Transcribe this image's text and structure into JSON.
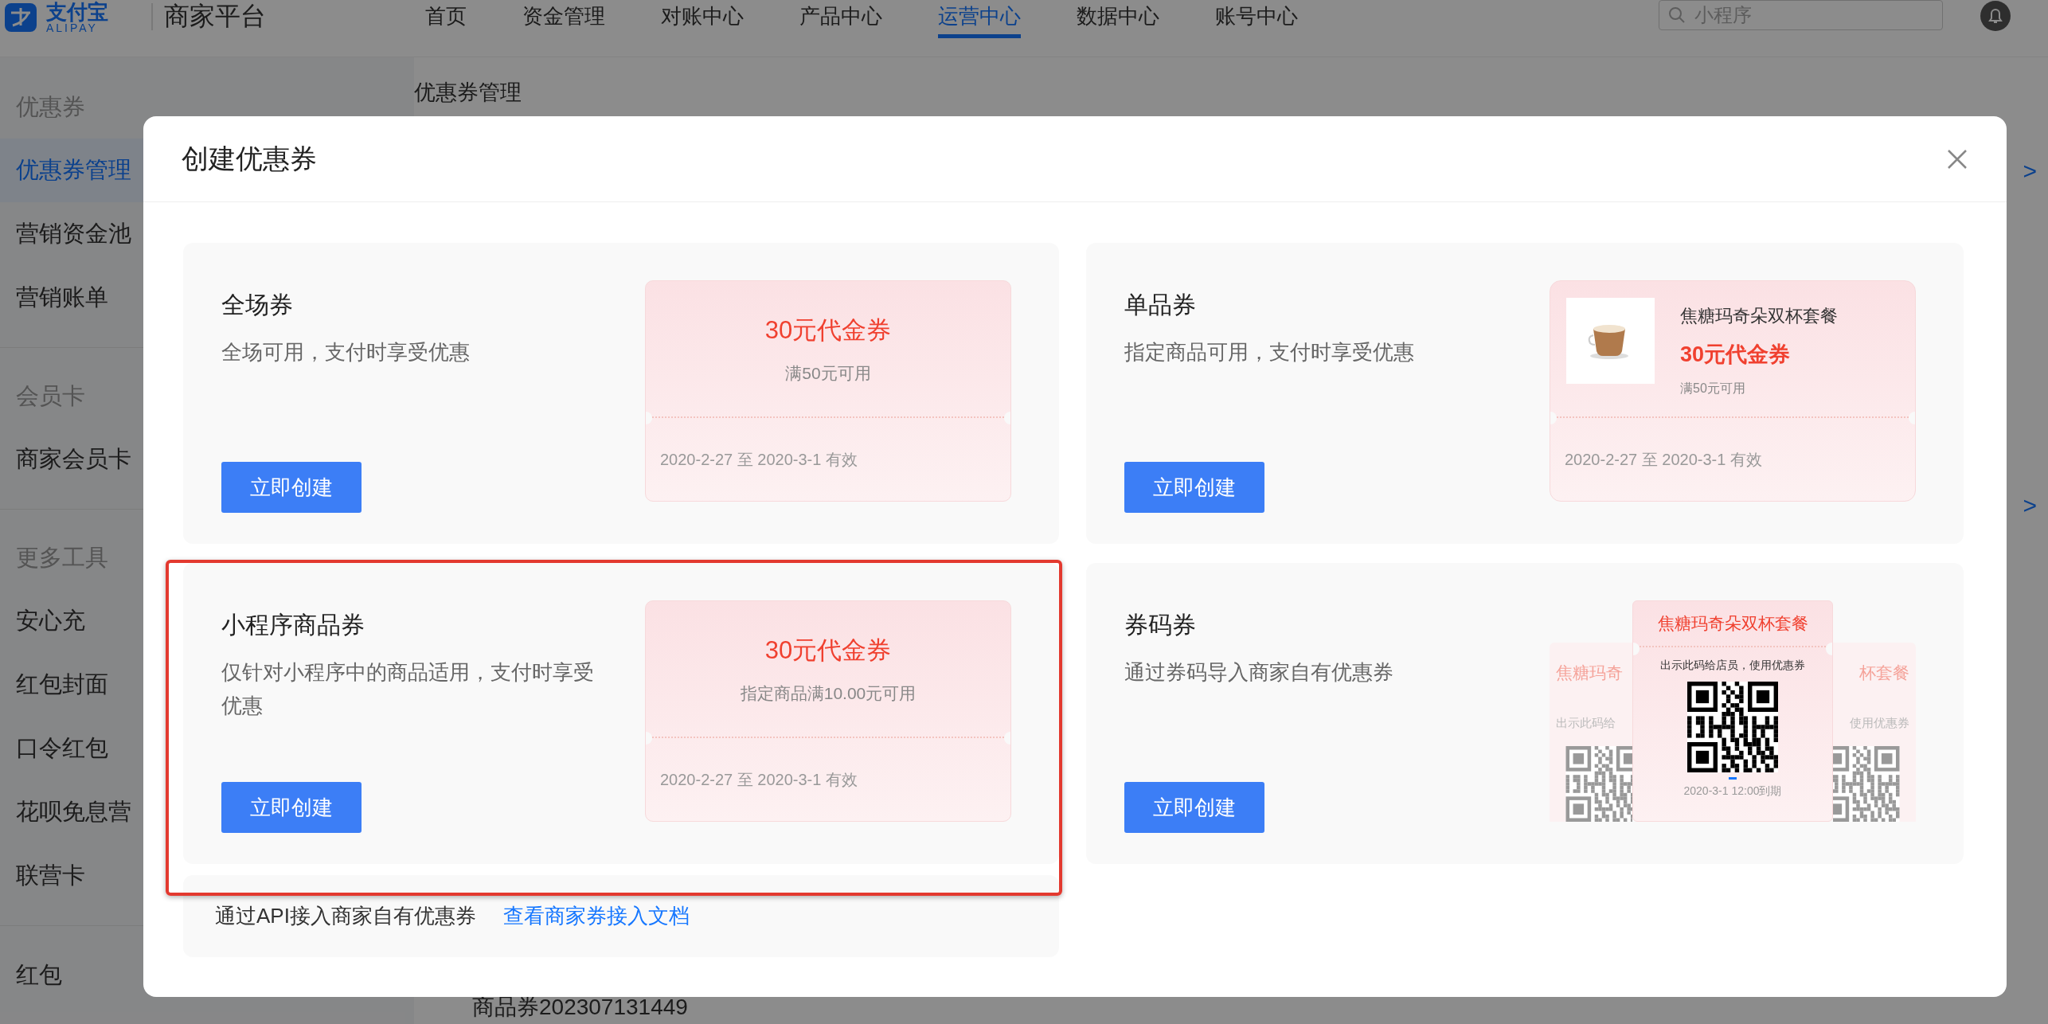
{
  "header": {
    "logo": {
      "name": "支付宝",
      "sub": "ALIPAY"
    },
    "platform": "商家平台",
    "nav": [
      {
        "label": "首页",
        "selected": false
      },
      {
        "label": "资金管理",
        "selected": false
      },
      {
        "label": "对账中心",
        "selected": false
      },
      {
        "label": "产品中心",
        "selected": false
      },
      {
        "label": "运营中心",
        "selected": true
      },
      {
        "label": "数据中心",
        "selected": false
      },
      {
        "label": "账号中心",
        "selected": false
      }
    ],
    "search": {
      "placeholder": "小程序"
    }
  },
  "sidebar": {
    "groups": [
      {
        "heading": "优惠券",
        "items": [
          {
            "label": "优惠券管理",
            "selected": true
          },
          {
            "label": "营销资金池",
            "selected": false
          },
          {
            "label": "营销账单",
            "selected": false
          }
        ]
      },
      {
        "heading": "会员卡",
        "items": [
          {
            "label": "商家会员卡",
            "selected": false
          }
        ]
      },
      {
        "heading": "更多工具",
        "items": [
          {
            "label": "安心充",
            "selected": false
          },
          {
            "label": "红包封面",
            "selected": false
          },
          {
            "label": "口令红包",
            "selected": false
          },
          {
            "label": "花呗免息营",
            "selected": false
          },
          {
            "label": "联营卡",
            "selected": false
          }
        ]
      },
      {
        "items": [
          {
            "label": "红包",
            "selected": false
          }
        ]
      }
    ]
  },
  "breadcrumb": "优惠券管理",
  "background_links": [
    ">",
    ">"
  ],
  "background_row": "商品券202307131449",
  "dialog": {
    "title": "创建优惠券",
    "cards": [
      {
        "title": "全场券",
        "description": "全场可用，支付时享受优惠",
        "button": "立即创建",
        "highlighted": false,
        "preview": {
          "kind": "voucher",
          "amount": "30元代金券",
          "condition": "满50元可用",
          "validity": "2020-2-27 至 2020-3-1 有效"
        }
      },
      {
        "title": "单品券",
        "description": "指定商品可用，支付时享受优惠",
        "button": "立即创建",
        "highlighted": false,
        "preview": {
          "kind": "product",
          "product": "焦糖玛奇朵双杯套餐",
          "amount": "30元代金券",
          "condition": "满50元可用",
          "validity": "2020-2-27 至 2020-3-1 有效"
        }
      },
      {
        "title": "小程序商品券",
        "description": "仅针对小程序中的商品适用，支付时享受优惠",
        "button": "立即创建",
        "highlighted": true,
        "preview": {
          "kind": "voucher",
          "amount": "30元代金券",
          "condition": "指定商品满10.00元可用",
          "validity": "2020-2-27 至 2020-3-1 有效"
        }
      },
      {
        "title": "券码券",
        "description": "通过券码导入商家自有优惠券",
        "button": "立即创建",
        "highlighted": false,
        "preview": {
          "kind": "code",
          "product": "焦糖玛奇朵双杯套餐",
          "instruction": "出示此码给店员，使用优惠券",
          "expiry": "2020-3-1 12:00到期",
          "back_left": {
            "title": "焦糖玛奇",
            "instruction": "出示此码给"
          },
          "back_right": {
            "title": "杯套餐",
            "instruction": "使用优惠券"
          }
        }
      }
    ],
    "footer": {
      "text": "通过API接入商家自有优惠券",
      "link": "查看商家券接入文档"
    }
  }
}
